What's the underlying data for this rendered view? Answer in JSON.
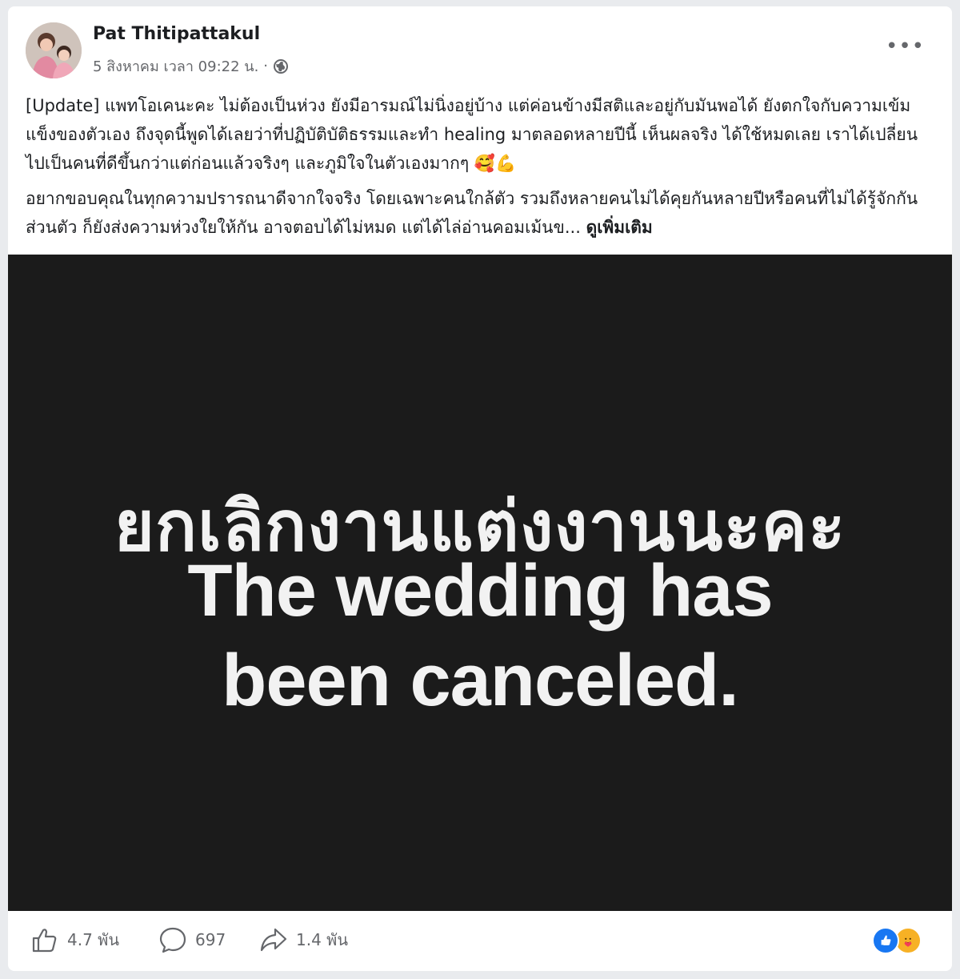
{
  "post": {
    "author": "Pat Thitipattakul",
    "timestamp": "5 สิงหาคม เวลา 09:22 น.",
    "separator": "·",
    "privacy_icon": "globe-icon",
    "more_label": "•••",
    "paragraph1": "[Update] แพทโอเคนะคะ ไม่ต้องเป็นห่วง ยังมีอารมณ์ไม่นิ่งอยู่บ้าง แต่ค่อนข้างมีสติและอยู่กับมันพอได้ ยังตกใจกับความเข้มแข็งของตัวเอง ถึงจุดนี้พูดได้เลยว่าที่ปฏิบัติบัติธรรมและทำ healing มาตลอดหลายปีนี้ เห็นผลจริง ได้ใช้หมดเลย เราได้เปลี่ยนไปเป็นคนที่ดีขึ้นกว่าแต่ก่อนแล้วจริงๆ และภูมิใจในตัวเองมากๆ 🥰💪",
    "paragraph2": "อยากขอบคุณในทุกความปรารถนาดีจากใจจริง โดยเฉพาะคนใกล้ตัว รวมถึงหลายคนไม่ได้คุยกันหลายปีหรือคนที่ไม่ได้รู้จักกันส่วนตัว ก็ยังส่งความห่วงใยให้กัน อาจตอบได้ไม่หมด แต่ได้ไล่อ่านคอมเม้นข...",
    "see_more": "ดูเพิ่มเติม"
  },
  "image": {
    "line_thai": "ยกเลิกงานแต่งงานนะคะ",
    "line_en_1": "The wedding has",
    "line_en_2": "been canceled.",
    "background": "#1b1b1b",
    "text_color": "#f2f2f2"
  },
  "footer": {
    "like_count": "4.7 พัน",
    "comment_count": "697",
    "share_count": "1.4 พัน",
    "like_icon": "thumbs-up-icon",
    "comment_icon": "comment-bubble-icon",
    "share_icon": "share-arrow-icon",
    "reaction_icons": [
      "like-reaction-icon",
      "care-reaction-icon"
    ]
  },
  "colors": {
    "like_blue": "#1877f2",
    "care_yellow": "#f7b125",
    "secondary_text": "#65676b"
  }
}
